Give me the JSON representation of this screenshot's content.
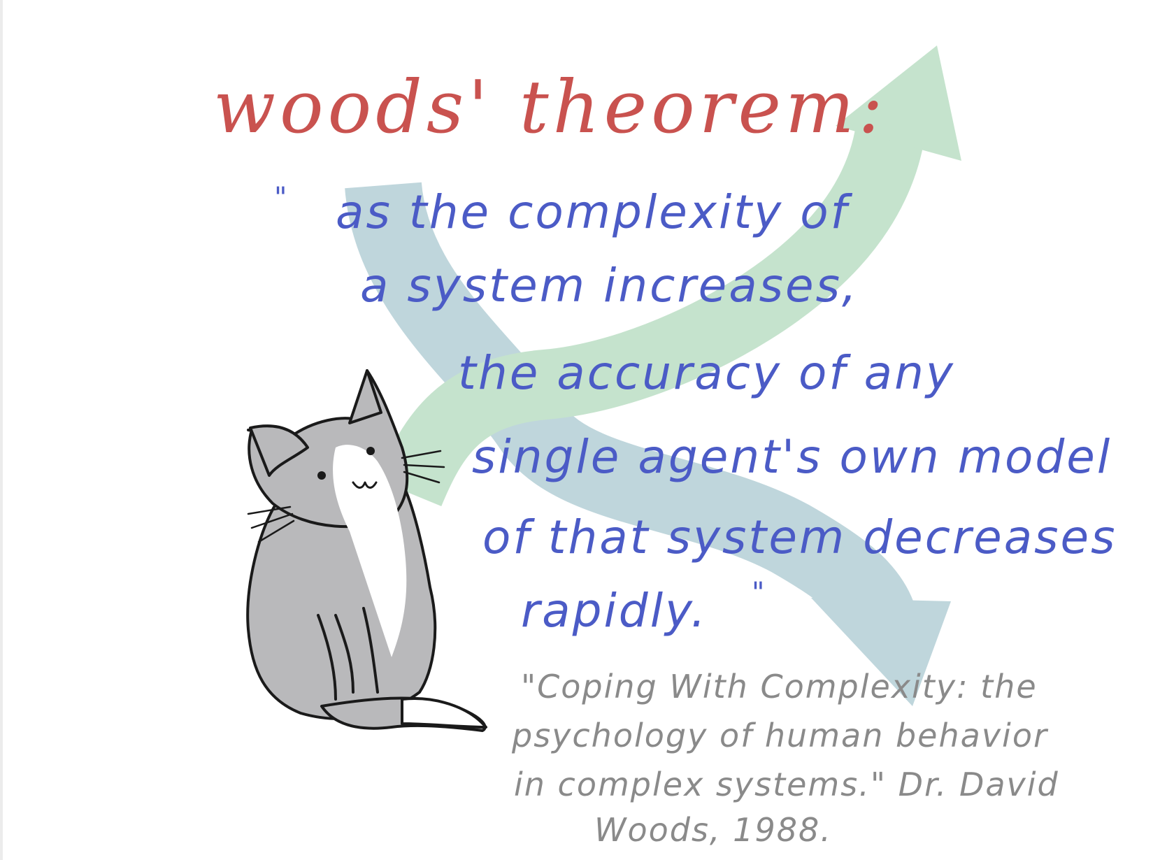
{
  "title": "woods' theorem:",
  "quote": {
    "open_mark": "\"",
    "close_mark": "\"",
    "lines": [
      "as the complexity of",
      "a system increases,",
      "the accuracy of any",
      "single agent's own model",
      "of that system decreases",
      "rapidly."
    ]
  },
  "citation": {
    "lines": [
      "\"Coping With Complexity: the",
      "psychology of human behavior",
      "in complex systems.\" Dr. David",
      "Woods, 1988."
    ]
  },
  "colors": {
    "title": "#c9524f",
    "quote": "#4b5bc6",
    "citation": "#8a8a8a",
    "rising_arrow": "#c5e3cd",
    "falling_arrow": "#bfd6dc",
    "cat_body": "#b9b9bb",
    "cat_outline": "#1a1a1a"
  },
  "illustrations": {
    "rising_arrow": "rising-arrow",
    "falling_arrow": "falling-arrow",
    "cat": "cat"
  }
}
